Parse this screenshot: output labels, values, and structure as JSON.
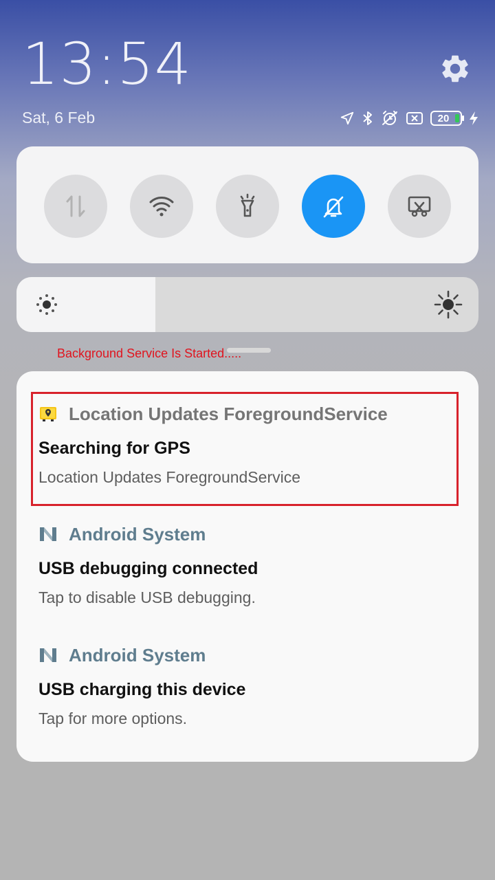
{
  "status": {
    "time": "13:54",
    "date": "Sat, 6 Feb",
    "battery_level": "20",
    "icons": [
      "location-arrow-icon",
      "bluetooth-icon",
      "alarm-off-icon",
      "sim-none-icon",
      "battery-icon",
      "charging-bolt-icon"
    ]
  },
  "quick_settings": {
    "tiles": [
      {
        "name": "mobile-data",
        "active": false
      },
      {
        "name": "wifi",
        "active": false
      },
      {
        "name": "flashlight",
        "active": false
      },
      {
        "name": "silent-mode",
        "active": true
      },
      {
        "name": "screenshot",
        "active": false
      }
    ],
    "brightness_level": 0.3,
    "accent": "#1a95f5"
  },
  "overlay_text": "Background Service Is Started.....",
  "notifications": [
    {
      "app": "Location Updates ForegroundService",
      "title": "Searching for GPS",
      "text": "Location Updates ForegroundService",
      "app_color": "#757575",
      "icon": "location-map-icon"
    },
    {
      "app": "Android System",
      "title": "USB debugging connected",
      "text": "Tap to disable USB debugging.",
      "app_color": "#5f7d8e",
      "icon": "android-n-icon"
    },
    {
      "app": "Android System",
      "title": "USB charging this device",
      "text": "Tap for more options.",
      "app_color": "#5f7d8e",
      "icon": "android-n-icon"
    }
  ]
}
